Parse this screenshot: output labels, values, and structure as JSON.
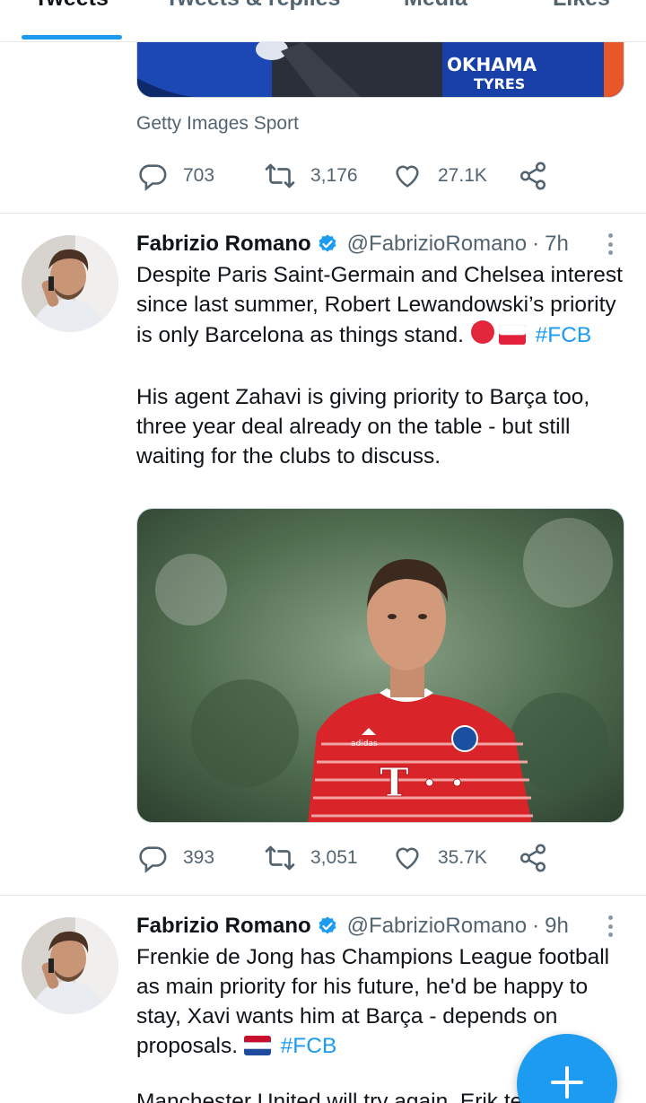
{
  "tabs": [
    {
      "label": "Tweets",
      "active": true
    },
    {
      "label": "Tweets & replies",
      "active": false
    },
    {
      "label": "Media",
      "active": false
    },
    {
      "label": "Likes",
      "active": false
    }
  ],
  "accent_color": "#1d9bf0",
  "top_media": {
    "caption": "Getty Images Sport",
    "sponsor_text_1": "OKHAMA",
    "sponsor_text_2": "TYRES"
  },
  "tweet0_actions": {
    "replies": "703",
    "retweets": "3,176",
    "likes": "27.1K"
  },
  "tweet1": {
    "name": "Fabrizio Romano",
    "handle": "@FabrizioRomano",
    "separator": "·",
    "time": "7h",
    "text_para1": "Despite Paris Saint-Germain and Chelsea interest since last summer, Robert Lewandowski’s priority is only Barcelona as things stand.",
    "hashtag": "#FCB",
    "text_para2": "His agent Zahavi is giving priority to Barça too, three year deal already on the table - but still waiting for the clubs to discuss.",
    "jersey_text": "T · ·",
    "actions": {
      "replies": "393",
      "retweets": "3,051",
      "likes": "35.7K"
    }
  },
  "tweet2": {
    "name": "Fabrizio Romano",
    "handle": "@FabrizioRomano",
    "separator": "·",
    "time": "9h",
    "text": "Frenkie de Jong has Champions League football as main priority for his future, he'd be happy to stay, Xavi wants him at Barça - depends on proposals.",
    "hashtag": "#FCB",
    "cut_text": "Manchester United will try again. Erik ten"
  },
  "fab": {
    "icon": "plus-icon"
  }
}
